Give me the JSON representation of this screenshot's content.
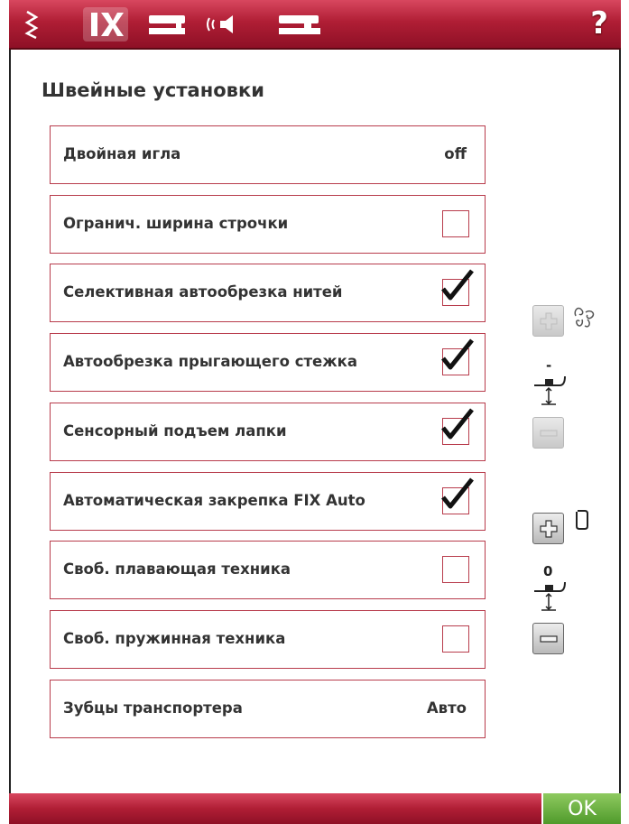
{
  "header": {
    "help_label": "?",
    "icons": [
      "stitch-icon",
      "settings-fix-icon",
      "sewing-machine-icon",
      "sound-icon",
      "machine-info-icon"
    ]
  },
  "page_title": "Швейные установки",
  "settings": [
    {
      "label": "Двойная игла",
      "kind": "value",
      "value": "off"
    },
    {
      "label": "Огранич. ширина строчки",
      "kind": "checkbox",
      "checked": false
    },
    {
      "label": "Селективная автообрезка нитей",
      "kind": "checkbox",
      "checked": true
    },
    {
      "label": "Автообрезка прыгающего стежка",
      "kind": "checkbox",
      "checked": true
    },
    {
      "label": "Сенсорный подъем лапки",
      "kind": "checkbox",
      "checked": true
    },
    {
      "label": "Автоматическая закрепка FIX Auto",
      "kind": "checkbox",
      "checked": true
    },
    {
      "label": "Своб. плавающая техника",
      "kind": "checkbox",
      "checked": false
    },
    {
      "label": "Своб. пружинная техника",
      "kind": "checkbox",
      "checked": false
    },
    {
      "label": "Зубцы транспортера",
      "kind": "value",
      "value": "Авто"
    }
  ],
  "presser_foot_pressure": {
    "value": "-",
    "enabled": false
  },
  "presser_foot_height": {
    "value": "0",
    "enabled": true
  },
  "footer": {
    "ok_label": "OK"
  },
  "colors": {
    "accent": "#b01e35",
    "border": "#b83c4c",
    "ok": "#5ea636"
  }
}
